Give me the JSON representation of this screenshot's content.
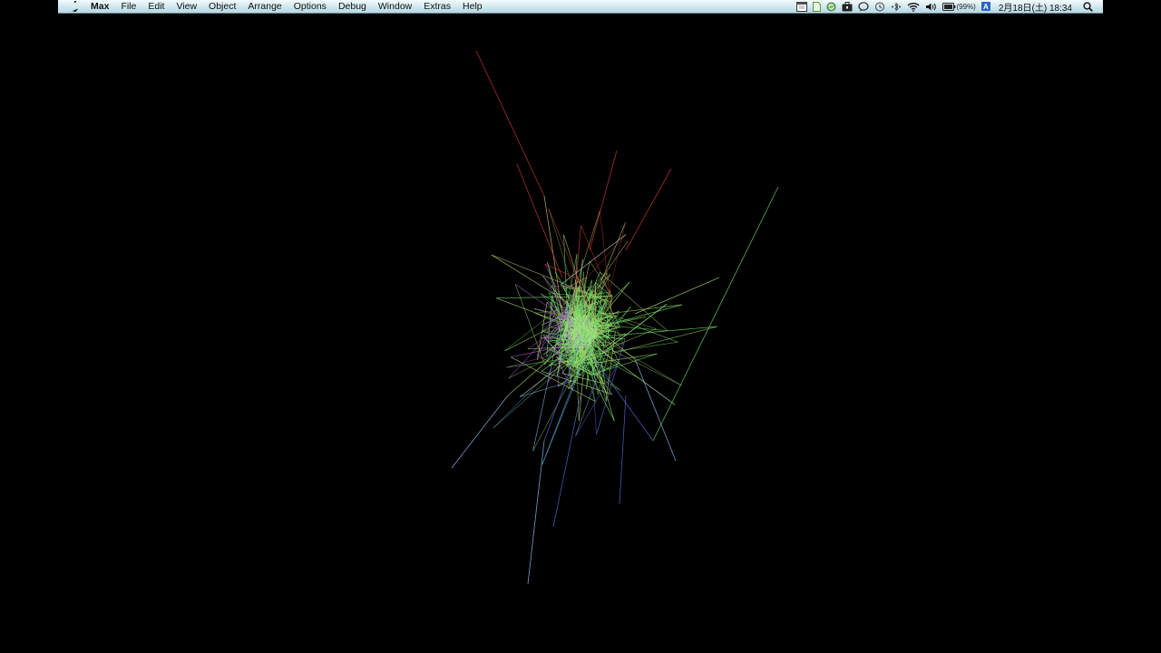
{
  "menubar": {
    "app_name": "Max",
    "menus": [
      "File",
      "Edit",
      "View",
      "Object",
      "Arrange",
      "Options",
      "Debug",
      "Window",
      "Extras",
      "Help"
    ],
    "status_icons": [
      "calendar-icon",
      "document-icon",
      "sync-icon",
      "briefcase-icon",
      "chat-icon",
      "time-machine-icon",
      "bluetooth-dots-icon",
      "wifi-icon",
      "volume-icon",
      "battery-icon",
      "input-method-icon",
      "spotlight-search-icon"
    ],
    "battery": "(99%)",
    "input_method": "A",
    "clock": "2月18日(土)  18:34"
  },
  "canvas": {
    "background": "#000000",
    "palette": [
      "#d03a3a",
      "#e05050",
      "#c8c46a",
      "#a8d86a",
      "#6ae06a",
      "#5ab0e0",
      "#5a6ad8",
      "#b05ad8",
      "#d0d0d0",
      "#9ac0ff"
    ]
  }
}
